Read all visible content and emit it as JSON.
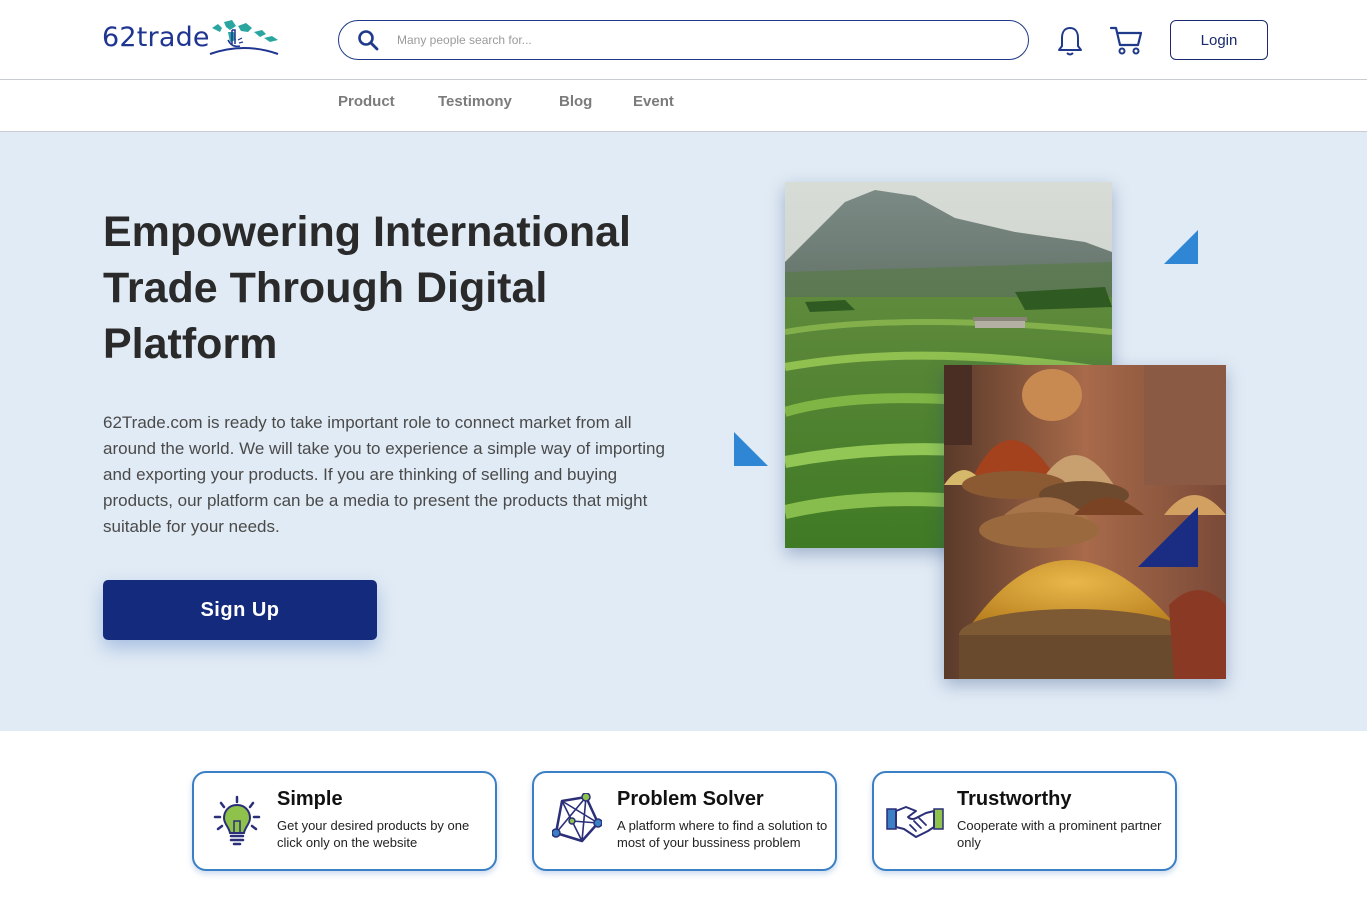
{
  "header": {
    "logo_text": "62trade",
    "search_placeholder": "Many people search for...",
    "login_label": "Login",
    "icons": [
      "search-icon",
      "bell-icon",
      "cart-icon"
    ]
  },
  "nav": {
    "items": [
      {
        "label": "Product"
      },
      {
        "label": "Testimony"
      },
      {
        "label": "Blog"
      },
      {
        "label": "Event"
      }
    ]
  },
  "hero": {
    "title": "Empowering International Trade Through Digital Platform",
    "description": "62Trade.com is ready to take important role to connect market from all around the world. We will take you to experience a simple way of importing and exporting your products. If you are thinking of selling and buying products, our platform can be a media to present the products that might suitable for your needs.",
    "signup_label": "Sign Up",
    "images": [
      "rice-terrace-photo",
      "spice-market-photo"
    ]
  },
  "features": [
    {
      "title": "Simple",
      "desc": "Get your desired products by one click only on the website",
      "icon": "lightbulb-icon"
    },
    {
      "title": "Problem Solver",
      "desc": "A platform where to find a solution to most of your bussiness problem",
      "icon": "network-icon"
    },
    {
      "title": "Trustworthy",
      "desc": "Cooperate with a prominent partner only",
      "icon": "handshake-icon"
    }
  ],
  "colors": {
    "brand": "#1f3591",
    "button": "#142a7c",
    "hero_bg": "#e1ebf5",
    "accent": "#2f86d4",
    "card_border": "#3b7fc4"
  }
}
